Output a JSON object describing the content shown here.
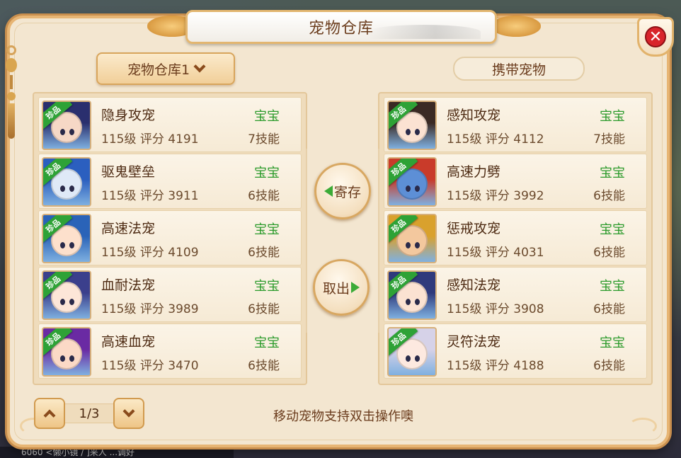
{
  "title": "宠物仓库",
  "storage_dropdown": {
    "label": "宠物仓库1"
  },
  "carry_header": "携带宠物",
  "actions": {
    "deposit": "寄存",
    "withdraw": "取出"
  },
  "rare_badge": "珍品",
  "pager": {
    "text": "1/3"
  },
  "hint": "移动宠物支持双击操作噢",
  "bottom_chat": "6060  <懒小镜   /  ]来人  ...调好",
  "storage_pets": [
    {
      "name": "隐身攻宠",
      "level": "115级",
      "score_label": "评分",
      "score": "4191",
      "type": "宝宝",
      "skills": "7技能",
      "face": "#f6d8c6",
      "hair": "#2a2f6e"
    },
    {
      "name": "驱鬼壁垒",
      "level": "115级",
      "score_label": "评分",
      "score": "3911",
      "type": "宝宝",
      "skills": "6技能",
      "face": "#dfe9f7",
      "hair": "#2b5fbf"
    },
    {
      "name": "高速法宠",
      "level": "115级",
      "score_label": "评分",
      "score": "4109",
      "type": "宝宝",
      "skills": "6技能",
      "face": "#fde0cc",
      "hair": "#2a63b8"
    },
    {
      "name": "血耐法宠",
      "level": "115级",
      "score_label": "评分",
      "score": "3989",
      "type": "宝宝",
      "skills": "6技能",
      "face": "#fde6d8",
      "hair": "#3b3f8c"
    },
    {
      "name": "高速血宠",
      "level": "115级",
      "score_label": "评分",
      "score": "3470",
      "type": "宝宝",
      "skills": "6技能",
      "face": "#fbd9c6",
      "hair": "#6a2aa3"
    }
  ],
  "carried_pets": [
    {
      "name": "感知攻宠",
      "level": "115级",
      "score_label": "评分",
      "score": "4112",
      "type": "宝宝",
      "skills": "7技能",
      "face": "#fbe2d2",
      "hair": "#3b2a24"
    },
    {
      "name": "高速力劈",
      "level": "115级",
      "score_label": "评分",
      "score": "3992",
      "type": "宝宝",
      "skills": "6技能",
      "face": "#5d8fd6",
      "hair": "#c93b2a"
    },
    {
      "name": "惩戒攻宠",
      "level": "115级",
      "score_label": "评分",
      "score": "4031",
      "type": "宝宝",
      "skills": "6技能",
      "face": "#f3c89e",
      "hair": "#d9a12d"
    },
    {
      "name": "感知法宠",
      "level": "115级",
      "score_label": "评分",
      "score": "3908",
      "type": "宝宝",
      "skills": "6技能",
      "face": "#fbe2d2",
      "hair": "#2f3a7c"
    },
    {
      "name": "灵符法宠",
      "level": "115级",
      "score_label": "评分",
      "score": "4188",
      "type": "宝宝",
      "skills": "6技能",
      "face": "#fde9e0",
      "hair": "#d6d2e8"
    }
  ],
  "colors": {
    "panel_bg": "#f3e6d0",
    "panel_border": "#e7b574",
    "type_green": "#2a9a2a",
    "badge_green": "#2ea236",
    "close_red": "#d8242b"
  },
  "icons": {
    "close": "close-icon",
    "deposit_arrow": "arrow-left-icon",
    "withdraw_arrow": "arrow-right-icon",
    "dropdown": "chevron-down-icon",
    "page_up": "chevron-up-icon",
    "page_down": "chevron-down-icon"
  }
}
